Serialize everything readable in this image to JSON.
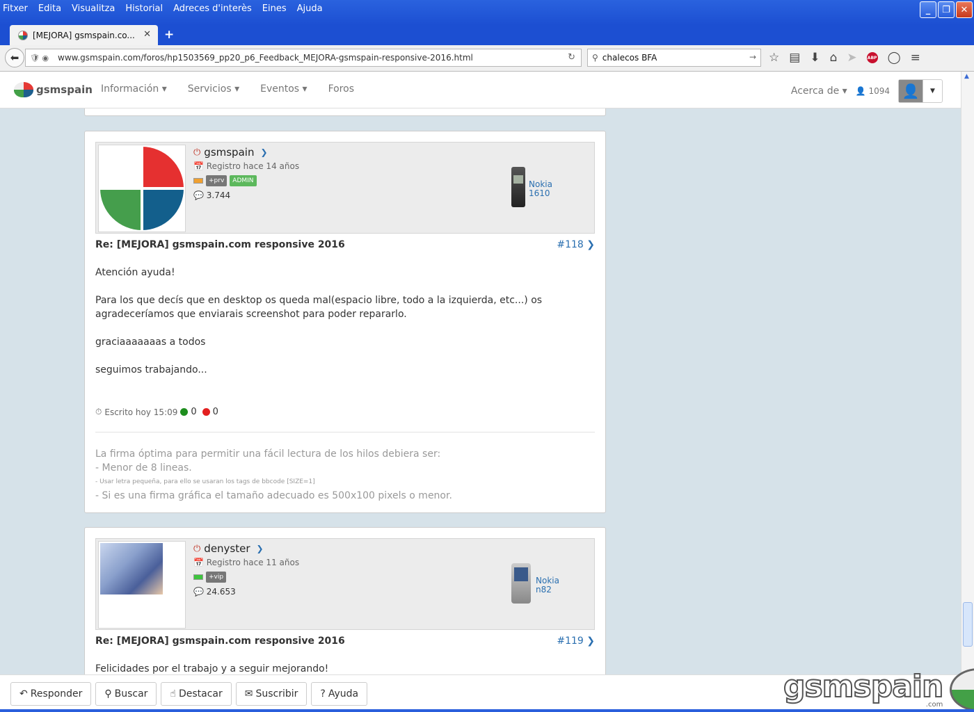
{
  "menubar": [
    "Fitxer",
    "Edita",
    "Visualitza",
    "Historial",
    "Adreces d'interès",
    "Eines",
    "Ajuda"
  ],
  "tab": {
    "title": "[MEJORA] gsmspain.co..."
  },
  "urlbar": {
    "url": "www.gsmspain.com/foros/hp1503569_pp20_p6_Feedback_MEJORA-gsmspain-responsive-2016.html"
  },
  "searchbar": {
    "value": "chalecos BFA"
  },
  "site": {
    "logo": "gsmspain",
    "nav": [
      "Información",
      "Servicios",
      "Eventos",
      "Foros"
    ],
    "acerca": "Acerca de",
    "users": "1094"
  },
  "posts": [
    {
      "user": "gsmspain",
      "registered": "Registro hace 14 años",
      "badge1": "+prv",
      "badge2": "ADMIN",
      "messages": "3.744",
      "phone_brand": "Nokia",
      "phone_model": "1610",
      "title": "Re: [MEJORA] gsmspain.com responsive 2016",
      "number": "#118",
      "body": [
        "Atención ayuda!",
        "Para los que decís que en desktop os queda mal(espacio libre, todo a la izquierda, etc...) os agradeceríamos que enviarais screenshot para poder repararlo.",
        "graciaaaaaaas a todos",
        "seguimos trabajando..."
      ],
      "written": "Escrito hoy 15:09",
      "likes": "0",
      "dislikes": "0",
      "signature": [
        "La firma óptima para permitir una fácil lectura de los hilos debiera ser:",
        "- Menor de 8 lineas.",
        "- Usar letra pequeña, para ello se usaran los tags de bbcode [SIZE=1]",
        "- Si es una firma gráfica el tamaño adecuado es 500x100 pixels o menor."
      ]
    },
    {
      "user": "denyster",
      "registered": "Registro hace 11 años",
      "badge1": "+vip",
      "messages": "24.653",
      "phone_brand": "Nokia",
      "phone_model": "n82",
      "title": "Re: [MEJORA] gsmspain.com responsive 2016",
      "number": "#119",
      "body": [
        "Felicidades por el trabajo y a seguir mejorando!"
      ]
    }
  ],
  "bottombar": {
    "buttons": [
      "Responder",
      "Buscar",
      "Destacar",
      "Suscribir",
      "Ayuda"
    ],
    "logo": "gsmspain",
    "logo_sub": ".com"
  }
}
